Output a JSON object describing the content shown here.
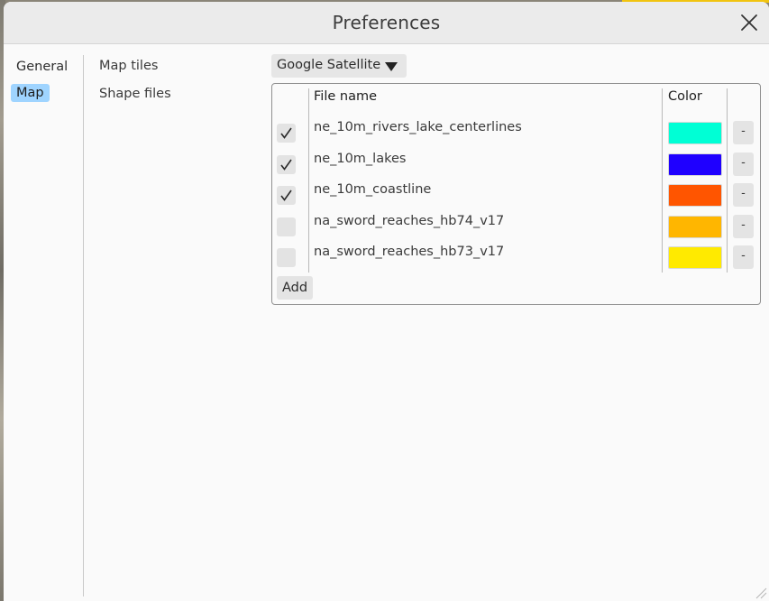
{
  "window": {
    "title": "Preferences"
  },
  "nav": {
    "items": [
      {
        "label": "General",
        "active": false
      },
      {
        "label": "Map",
        "active": true
      }
    ]
  },
  "settings": {
    "map_tiles_label": "Map tiles",
    "map_tiles_value": "Google Satellite",
    "shape_files_label": "Shape files"
  },
  "shape_table": {
    "headers": {
      "file_name": "File name",
      "color": "Color"
    },
    "rows": [
      {
        "checked": true,
        "file_name": "ne_10m_rivers_lake_centerlines",
        "color": "#00ffd5",
        "remove_label": "-"
      },
      {
        "checked": true,
        "file_name": "ne_10m_lakes",
        "color": "#1f00ff",
        "remove_label": "-"
      },
      {
        "checked": true,
        "file_name": "ne_10m_coastline",
        "color": "#ff5500",
        "remove_label": "-"
      },
      {
        "checked": false,
        "file_name": "na_sword_reaches_hb74_v17",
        "color": "#ffb600",
        "remove_label": "-"
      },
      {
        "checked": false,
        "file_name": "na_sword_reaches_hb73_v17",
        "color": "#ffea00",
        "remove_label": "-"
      }
    ],
    "add_label": "Add"
  },
  "icons": {
    "close": "close-icon",
    "dropdown": "caret-down-icon",
    "check": "check-icon",
    "resize": "resize-grip-icon"
  }
}
